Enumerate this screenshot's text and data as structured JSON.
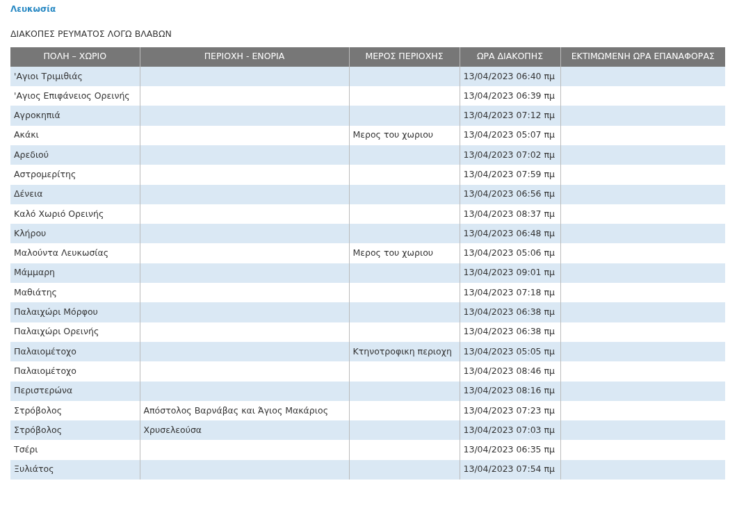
{
  "region_title": "Λευκωσία",
  "heading": "ΔΙΑΚΟΠΕΣ ΡΕΥΜΑΤΟΣ ΛΟΓΩ ΒΛΑΒΩΝ",
  "table": {
    "columns": [
      "ΠΟΛΗ – ΧΩΡΙΟ",
      "ΠΕΡΙΟΧΗ - ΕΝΟΡΙΑ",
      "ΜΕΡΟΣ ΠΕΡΙΟΧΗΣ",
      "ΩΡΑ ΔΙΑΚΟΠΗΣ",
      "ΕΚΤΙΜΩΜΕΝΗ ΩΡΑ ΕΠΑΝΑΦΟΡΑΣ"
    ],
    "rows": [
      {
        "village": "'Αγιοι Τριμιθιάς",
        "outage_time": "13/04/2023 06:40 πμ"
      },
      {
        "village": "'Αγιος Επιφάνειος Ορεινής",
        "outage_time": "13/04/2023 06:39 πμ"
      },
      {
        "village": "Αγροκηπιά",
        "outage_time": "13/04/2023 07:12 πμ"
      },
      {
        "village": "Ακάκι",
        "area_part": "Μερος του χωριου",
        "outage_time": "13/04/2023 05:07 πμ"
      },
      {
        "village": "Αρεδιού",
        "outage_time": "13/04/2023 07:02 πμ"
      },
      {
        "village": "Αστρομερίτης",
        "outage_time": "13/04/2023 07:59 πμ"
      },
      {
        "village": "Δένεια",
        "outage_time": "13/04/2023 06:56 πμ"
      },
      {
        "village": "Καλό Χωριό Ορεινής",
        "outage_time": "13/04/2023 08:37 πμ"
      },
      {
        "village": "Κλήρου",
        "outage_time": "13/04/2023 06:48 πμ"
      },
      {
        "village": "Μαλούντα Λευκωσίας",
        "area_part": "Μερος του χωριου",
        "outage_time": "13/04/2023 05:06 πμ"
      },
      {
        "village": "Μάμμαρη",
        "outage_time": "13/04/2023 09:01 πμ"
      },
      {
        "village": "Μαθιάτης",
        "outage_time": "13/04/2023 07:18 πμ"
      },
      {
        "village": "Παλαιχώρι Μόρφου",
        "outage_time": "13/04/2023 06:38 πμ"
      },
      {
        "village": "Παλαιχώρι Ορεινής",
        "outage_time": "13/04/2023 06:38 πμ"
      },
      {
        "village": "Παλαιομέτοχο",
        "area_part": "Κτηνοτροφικη περιοχη",
        "outage_time": "13/04/2023 05:05 πμ"
      },
      {
        "village": "Παλαιομέτοχο",
        "outage_time": "13/04/2023 08:46 πμ"
      },
      {
        "village": "Περιστερώνα",
        "outage_time": "13/04/2023 08:16 πμ"
      },
      {
        "village": "Στρόβολος",
        "parish": "Απόστολος Βαρνάβας και Άγιος Μακάριος",
        "outage_time": "13/04/2023 07:23 πμ"
      },
      {
        "village": "Στρόβολος",
        "parish": "Χρυσελεούσα",
        "outage_time": "13/04/2023 07:03 πμ"
      },
      {
        "village": "Τσέρι",
        "outage_time": "13/04/2023 06:35 πμ"
      },
      {
        "village": "Ξυλιάτος",
        "outage_time": "13/04/2023 07:54 πμ"
      }
    ]
  }
}
